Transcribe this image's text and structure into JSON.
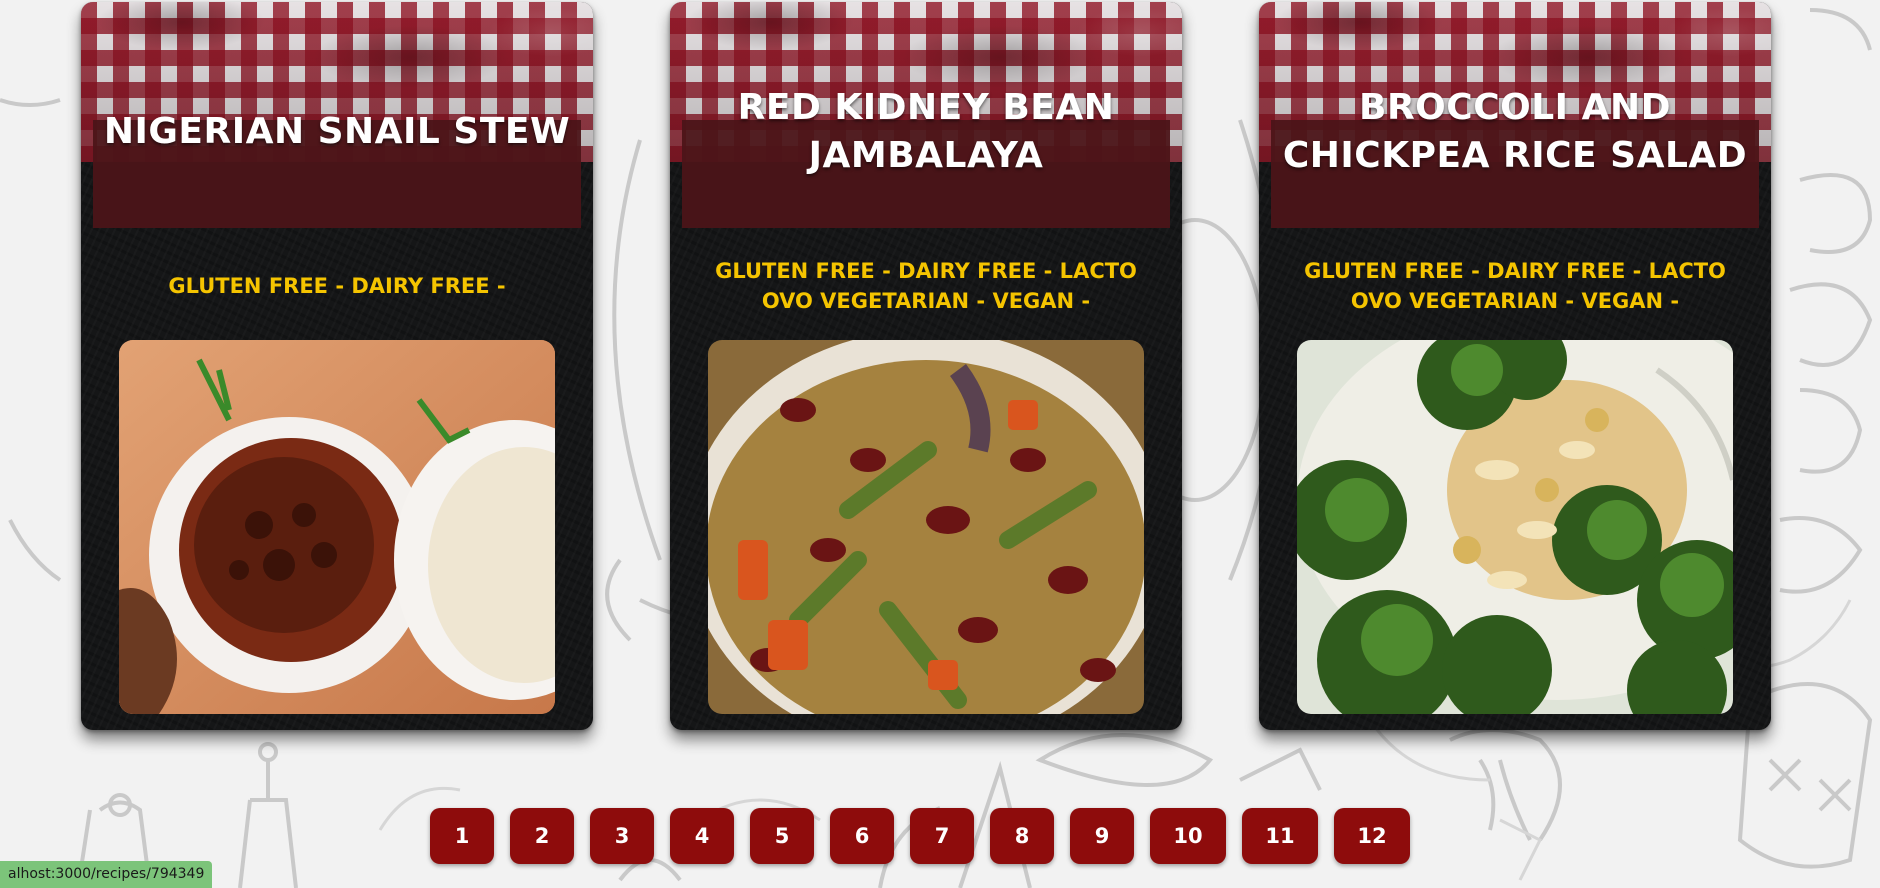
{
  "recipes": [
    {
      "title": "NIGERIAN SNAIL STEW",
      "diets": "GLUTEN FREE - DAIRY FREE -",
      "image": "nigerian-snail-stew-with-rice-photo"
    },
    {
      "title": "RED KIDNEY BEAN JAMBALAYA",
      "diets": "GLUTEN FREE - DAIRY FREE - LACTO OVO VEGETARIAN - VEGAN -",
      "image": "red-kidney-bean-jambalaya-photo"
    },
    {
      "title": "BROCCOLI AND CHICKPEA RICE SALAD",
      "diets": "GLUTEN FREE - DAIRY FREE - LACTO OVO VEGETARIAN - VEGAN -",
      "image": "broccoli-chickpea-rice-salad-photo"
    }
  ],
  "pagination": {
    "pages": [
      "1",
      "2",
      "3",
      "4",
      "5",
      "6",
      "7",
      "8",
      "9",
      "10",
      "11",
      "12"
    ]
  },
  "status_bar": {
    "url": "alhost:3000/recipes/794349"
  },
  "colors": {
    "accent_button": "#8e0c0c",
    "diet_text": "#f5c400",
    "title_band": "#4b1418",
    "card_background": "#151617",
    "status_bar": "#7cc47a"
  }
}
